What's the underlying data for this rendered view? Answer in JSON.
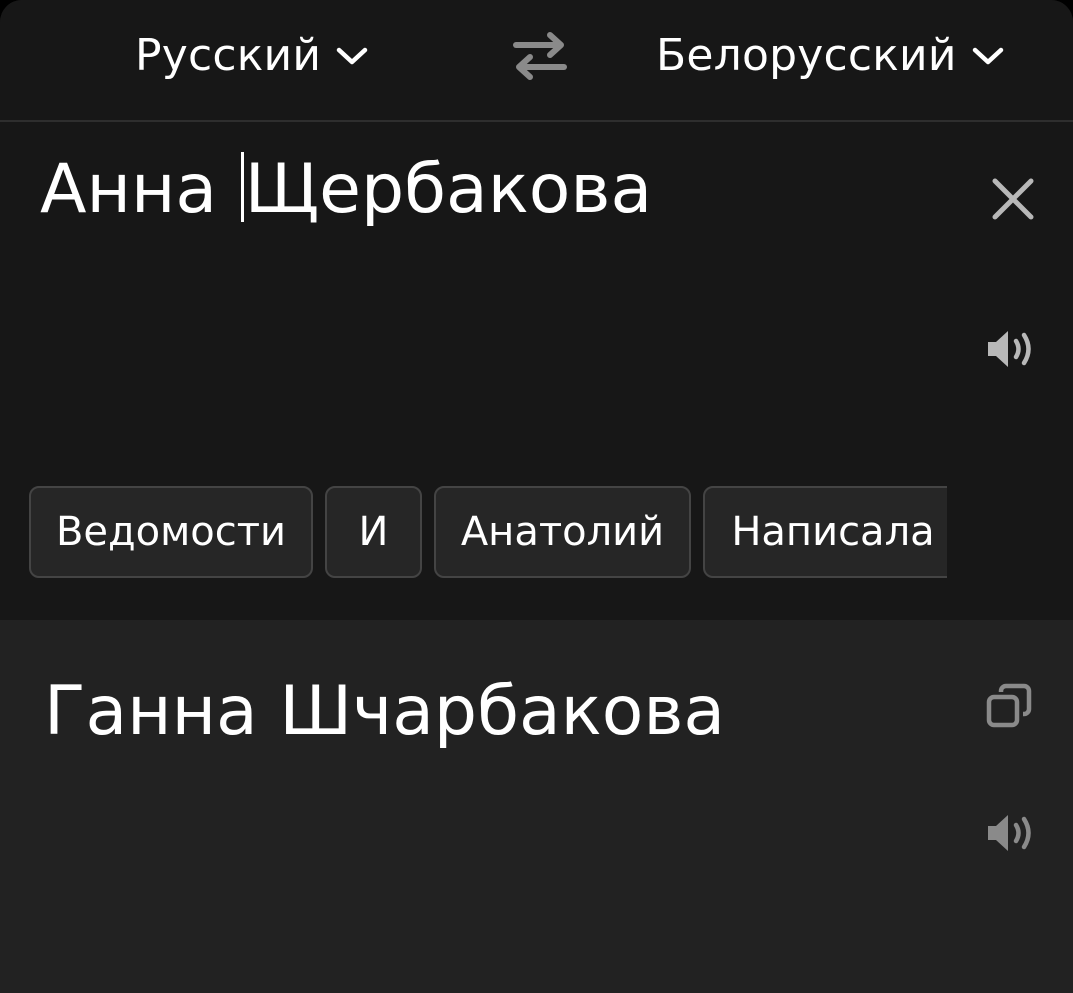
{
  "header": {
    "source_lang": "Русский",
    "target_lang": "Белорусский",
    "swap_icon": "swap-arrows-icon",
    "dropdown_icon": "chevron-down-icon"
  },
  "input": {
    "text_before_cursor": "Анна ",
    "text_after_cursor": "Щербакова",
    "clear_icon": "close-icon",
    "speak_icon": "speaker-icon"
  },
  "suggestions": [
    "Ведомости",
    "И",
    "Анатолий",
    "Написала"
  ],
  "output": {
    "translation": "Ганна Шчарбакова",
    "copy_icon": "copy-icon",
    "speak_icon": "speaker-icon"
  },
  "colors": {
    "background_top": "#171717",
    "background_output": "#222222",
    "chip_background": "#262626",
    "chip_border": "#444444",
    "icon_gray": "#8a8a8a",
    "icon_light": "#b8b8b8",
    "text": "#ffffff"
  }
}
